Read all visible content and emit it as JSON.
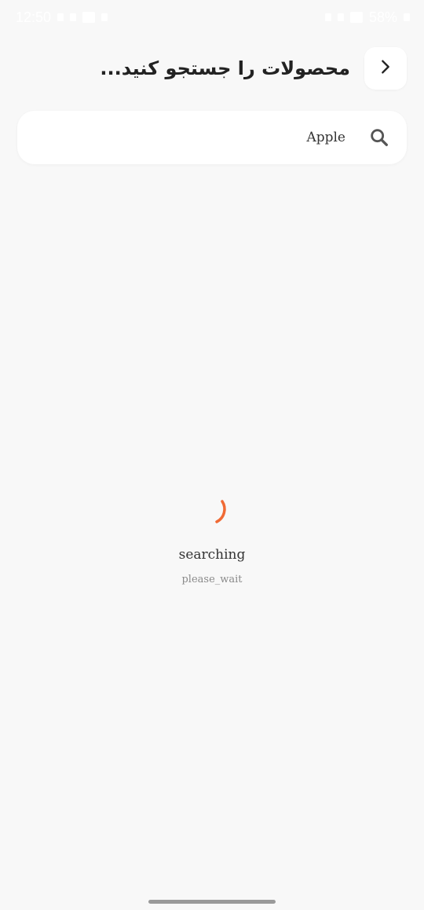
{
  "status_bar": {
    "time": "12:50",
    "battery": "58%"
  },
  "header": {
    "title": "محصولات را جستجو کنید...",
    "back_icon": "chevron-right-icon"
  },
  "search": {
    "value": "Apple",
    "icon": "search-icon"
  },
  "loading": {
    "title": "searching",
    "subtitle": "please_wait",
    "accent_color": "#f06a35"
  }
}
